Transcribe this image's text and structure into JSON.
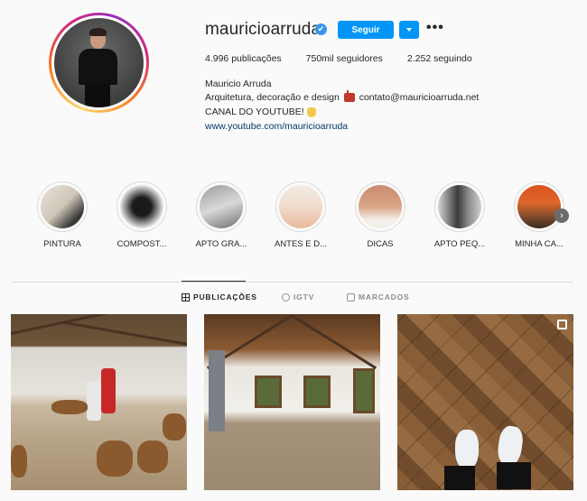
{
  "profile": {
    "username": "mauricioarruda",
    "verified_icon": "✔",
    "follow_label": "Seguir",
    "more_label": "•••",
    "stats": {
      "posts": "4.996",
      "posts_label": "publicações",
      "followers": "750mil",
      "followers_label": "seguidores",
      "following": "2.252",
      "following_label": "seguindo"
    },
    "full_name": "Mauricio Arruda",
    "bio_line1_a": "Arquitetura, decoração e design",
    "bio_line1_b": "contato@mauricioarruda.net",
    "bio_line2": "CANAL DO YOUTUBE!",
    "website": "www.youtube.com/mauricioarruda"
  },
  "highlights": [
    {
      "label": "PINTURA"
    },
    {
      "label": "COMPOST..."
    },
    {
      "label": "APTO GRA..."
    },
    {
      "label": "ANTES E D..."
    },
    {
      "label": "DICAS"
    },
    {
      "label": "APTO PEQ..."
    },
    {
      "label": "MINHA CA..."
    }
  ],
  "tabs": [
    {
      "label": "PUBLICAÇÕES",
      "icon": "grid-icon",
      "active": true
    },
    {
      "label": "IGTV",
      "icon": "igtv-icon",
      "active": false
    },
    {
      "label": "MARCADOS",
      "icon": "tagged-icon",
      "active": false
    }
  ],
  "colors": {
    "accent": "#0095f6",
    "verified": "#3897f0",
    "link": "#00376b",
    "text": "#262626",
    "muted": "#8e8e8e"
  }
}
